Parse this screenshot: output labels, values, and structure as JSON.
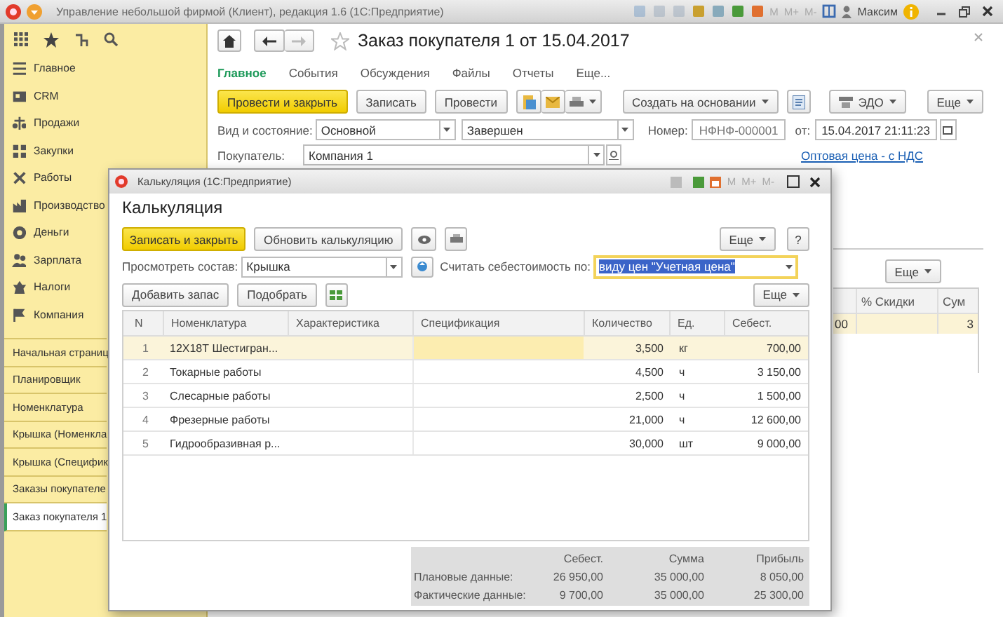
{
  "app_title_bar": {
    "title": "Управление небольшой фирмой (Клиент), редакция 1.6 (1С:Предприятие)",
    "memory_buttons": [
      "M",
      "M+",
      "M-"
    ],
    "user": "Максим"
  },
  "sections_panel": {
    "sections": [
      {
        "label": "Главное"
      },
      {
        "label": "CRM"
      },
      {
        "label": "Продажи"
      },
      {
        "label": "Закупки"
      },
      {
        "label": "Работы"
      },
      {
        "label": "Производство"
      },
      {
        "label": "Деньги"
      },
      {
        "label": "Зарплата"
      },
      {
        "label": "Налоги"
      },
      {
        "label": "Компания"
      }
    ],
    "open_windows": [
      {
        "label": "Начальная страниц",
        "selected": false
      },
      {
        "label": "Планировщик",
        "selected": false
      },
      {
        "label": "Номенклатура",
        "selected": false
      },
      {
        "label": "Крышка (Номенкла",
        "selected": false
      },
      {
        "label": "Крышка (Специфик",
        "selected": false
      },
      {
        "label": "Заказы покупателе",
        "selected": false
      },
      {
        "label": "Заказ покупателя 1",
        "selected": true
      }
    ]
  },
  "document": {
    "title": "Заказ покупателя 1 от 15.04.2017",
    "tabs": [
      {
        "label": "Главное",
        "selected": true
      },
      {
        "label": "События",
        "selected": false
      },
      {
        "label": "Обсуждения",
        "selected": false
      },
      {
        "label": "Файлы",
        "selected": false
      },
      {
        "label": "Отчеты",
        "selected": false
      },
      {
        "label": "Еще...",
        "selected": false
      }
    ],
    "toolbar": {
      "post_and_close": "Провести и закрыть",
      "save": "Записать",
      "post": "Провести",
      "create_based_on": "Создать на основании",
      "edo": "ЭДО",
      "more": "Еще"
    },
    "kind_label": "Вид и состояние:",
    "kind_value": "Основной",
    "state_value": "Завершен",
    "number_label": "Номер:",
    "number_value": "НФНФ-000001",
    "date_label": "от:",
    "date_value": "15.04.2017 21:11:23",
    "customer_label": "Покупатель:",
    "customer_value": "Компания 1",
    "price_link": "Оптовая цена - с НДС",
    "goods_table": {
      "more": "Еще",
      "columns": [
        "% Скидки",
        "Сум"
      ],
      "row": [
        "00",
        "3"
      ],
      "row_selected": true
    }
  },
  "calculation_dialog": {
    "window_title": "Калькуляция (1С:Предприятие)",
    "memory_buttons": [
      "M",
      "M+",
      "M-"
    ],
    "title": "Калькуляция",
    "save_and_close": "Записать и закрыть",
    "refresh": "Обновить калькуляцию",
    "more": "Еще",
    "help": "?",
    "view_label": "Просмотреть состав:",
    "view_value": "Крышка",
    "cost_label": "Считать себестоимость по:",
    "cost_value": "виду цен \"Учетная цена\"",
    "cost_focused": true,
    "add_stock": "Добавить запас",
    "pick": "Подобрать",
    "table_more": "Еще",
    "table": {
      "columns": [
        "N",
        "Номенклатура",
        "Характеристика",
        "Спецификация",
        "Количество",
        "Ед.",
        "Себест."
      ],
      "rows": [
        {
          "n": "1",
          "item": "12Х18Т Шестигран...",
          "quantity": "3,500",
          "unit": "кг",
          "cost": "700,00",
          "selected": true
        },
        {
          "n": "2",
          "item": "Токарные работы",
          "quantity": "4,500",
          "unit": "ч",
          "cost": "3 150,00",
          "selected": false
        },
        {
          "n": "3",
          "item": "Слесарные работы",
          "quantity": "2,500",
          "unit": "ч",
          "cost": "1 500,00",
          "selected": false
        },
        {
          "n": "4",
          "item": "Фрезерные работы",
          "quantity": "21,000",
          "unit": "ч",
          "cost": "12 600,00",
          "selected": false
        },
        {
          "n": "5",
          "item": "Гидрообразивная р...",
          "quantity": "30,000",
          "unit": "шт",
          "cost": "9 000,00",
          "selected": false
        }
      ]
    },
    "summary": {
      "columns": [
        "Себест.",
        "Сумма",
        "Прибыль"
      ],
      "rows": [
        {
          "label": "Плановые данные:",
          "values": [
            "26 950,00",
            "35 000,00",
            "8 050,00"
          ]
        },
        {
          "label": "Фактические данные:",
          "values": [
            "9 700,00",
            "35 000,00",
            "25 300,00"
          ]
        }
      ]
    }
  }
}
